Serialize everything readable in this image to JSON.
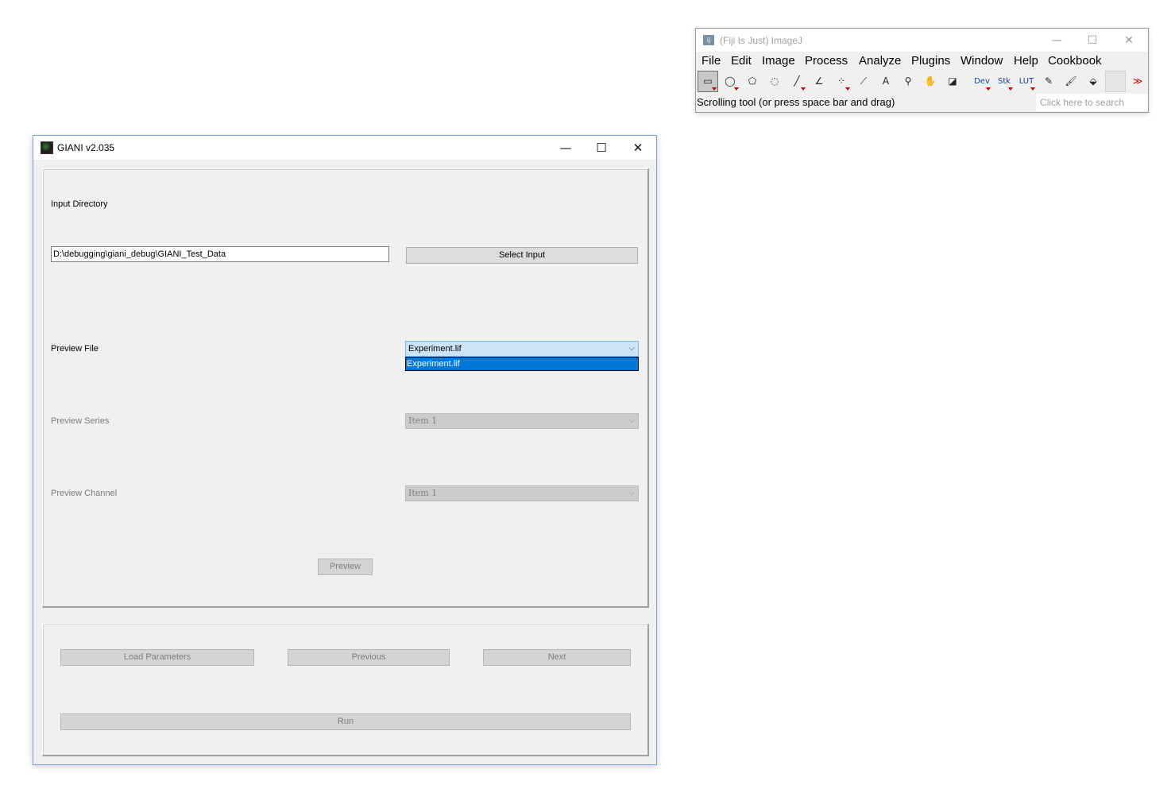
{
  "imagej": {
    "title": "(Fiji Is Just) ImageJ",
    "icon_text": "ij",
    "window_controls": {
      "minimize": "—",
      "maximize": "☐",
      "close": "✕"
    },
    "menu": [
      "File",
      "Edit",
      "Image",
      "Process",
      "Analyze",
      "Plugins",
      "Window",
      "Help",
      "Cookbook"
    ],
    "tools": [
      {
        "name": "rectangle-tool-icon",
        "glyph": "▭",
        "selected": true,
        "menu": true
      },
      {
        "name": "oval-tool-icon",
        "glyph": "◯",
        "menu": true
      },
      {
        "name": "polygon-tool-icon",
        "glyph": "⬠"
      },
      {
        "name": "freehand-tool-icon",
        "glyph": "◌"
      },
      {
        "name": "line-tool-icon",
        "glyph": "╱",
        "menu": true
      },
      {
        "name": "angle-tool-icon",
        "glyph": "∠"
      },
      {
        "name": "point-tool-icon",
        "glyph": "⁘",
        "menu": true
      },
      {
        "name": "wand-tool-icon",
        "glyph": "⟋"
      },
      {
        "name": "text-tool-icon",
        "glyph": "A"
      },
      {
        "name": "magnifier-tool-icon",
        "glyph": "⚲"
      },
      {
        "name": "hand-tool-icon",
        "glyph": "✋"
      },
      {
        "name": "color-picker-tool-icon",
        "glyph": "◪"
      },
      {
        "name": "dev-tool-icon",
        "glyph": "Dev",
        "small": true,
        "menu": true
      },
      {
        "name": "stk-tool-icon",
        "glyph": "Stk",
        "small": true,
        "menu": true
      },
      {
        "name": "lut-tool-icon",
        "glyph": "LUT",
        "small": true,
        "menu": true
      },
      {
        "name": "pencil-tool-icon",
        "glyph": "✎"
      },
      {
        "name": "brush-tool-icon",
        "glyph": "🖌"
      },
      {
        "name": "flood-fill-tool-icon",
        "glyph": "⬙"
      },
      {
        "name": "empty-tool-slot-icon",
        "glyph": ""
      },
      {
        "name": "more-tools-icon",
        "glyph": "≫"
      }
    ],
    "status": "Scrolling tool (or press space bar and drag)",
    "search_placeholder": "Click here to search"
  },
  "giani": {
    "title": "GIANI v2.035",
    "window_controls": {
      "minimize": "—",
      "maximize": "☐",
      "close": "✕"
    },
    "input_directory_label": "Input Directory",
    "input_directory_value": "D:\\debugging\\giani_debug\\GIANI_Test_Data",
    "select_input_label": "Select Input",
    "preview_file_label": "Preview File",
    "preview_file_value": "Experiment.lif",
    "preview_file_options": [
      "Experiment.lif"
    ],
    "preview_series_label": "Preview Series",
    "preview_series_value": "Item 1",
    "preview_channel_label": "Preview Channel",
    "preview_channel_value": "Item 1",
    "preview_button_label": "Preview",
    "load_parameters_label": "Load Parameters",
    "previous_label": "Previous",
    "next_label": "Next",
    "run_label": "Run",
    "chevron_glyph": "⌵"
  }
}
